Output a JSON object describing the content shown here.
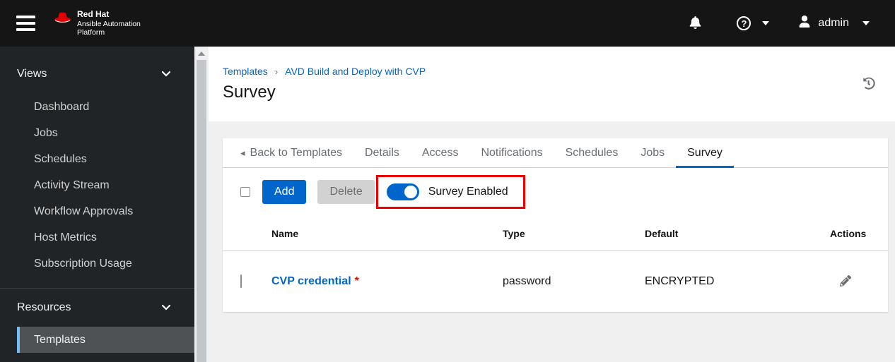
{
  "masthead": {
    "brand": {
      "line1": "Red Hat",
      "line2": "Ansible Automation",
      "line3": "Platform"
    },
    "username": "admin"
  },
  "icons": {
    "help_glyph": "?",
    "breadcrumb_separator": "›",
    "back_caret": "◂"
  },
  "sidebar": {
    "sections": [
      {
        "label": "Views",
        "items": [
          {
            "label": "Dashboard"
          },
          {
            "label": "Jobs"
          },
          {
            "label": "Schedules"
          },
          {
            "label": "Activity Stream"
          },
          {
            "label": "Workflow Approvals"
          },
          {
            "label": "Host Metrics"
          },
          {
            "label": "Subscription Usage"
          }
        ]
      },
      {
        "label": "Resources",
        "items": [
          {
            "label": "Templates",
            "current": true
          }
        ]
      }
    ]
  },
  "breadcrumb": {
    "items": [
      {
        "label": "Templates"
      },
      {
        "label": "AVD Build and Deploy with CVP"
      }
    ]
  },
  "page": {
    "title": "Survey"
  },
  "tabs": {
    "back_label": "Back to Templates",
    "items": [
      {
        "label": "Details"
      },
      {
        "label": "Access"
      },
      {
        "label": "Notifications"
      },
      {
        "label": "Schedules"
      },
      {
        "label": "Jobs"
      },
      {
        "label": "Survey",
        "active": true
      }
    ],
    "active": "Survey"
  },
  "toolbar": {
    "add_label": "Add",
    "delete_label": "Delete",
    "delete_disabled": true,
    "survey_toggle_label": "Survey Enabled",
    "survey_toggle_on": true
  },
  "table": {
    "headers": [
      "Name",
      "Type",
      "Default",
      "Actions"
    ],
    "rows": [
      {
        "name": "CVP credential",
        "required_marker": "*",
        "type": "password",
        "default": "ENCRYPTED"
      }
    ]
  },
  "colors": {
    "accent_blue": "#0066cc",
    "annotation_red": "#ee0000",
    "nav_current_border": "#73bcf7",
    "masthead_bg": "#151515",
    "sidebar_bg": "#212427",
    "content_bg": "#f0f0f0",
    "danger_red": "#c9190b"
  }
}
